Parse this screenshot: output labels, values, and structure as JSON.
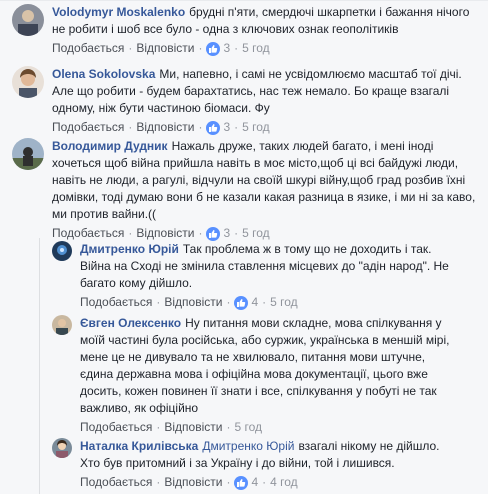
{
  "comments": [
    {
      "author": "Volodymyr Moskalenko",
      "lines": [
        "брудні п'яти, смердючі шкарпетки і бажання нічого",
        "не робити і шоб все було - одна з ключових ознак геополітиків"
      ],
      "like": "Подобається",
      "reply": "Відповісти",
      "likes": "3",
      "time": "5 год"
    },
    {
      "author": "Olena Sokolovska",
      "lines": [
        "Ми, напевно, і самі не усвідомлюємо масштаб тої дічі.",
        "Але що робити - будем барахтатись, нас теж немало. Бо краще взагалі",
        "одному, ніж бути частиною біомаси. Фу"
      ],
      "like": "Подобається",
      "reply": "Відповісти",
      "likes": "3",
      "time": "5 год"
    },
    {
      "author": "Володимир Дудник",
      "lines": [
        "Нажаль друже, таких людей багато, і мені іноді",
        "хочеться щоб війна прийшла навіть в моє місто,щоб ці всі байдужі люди,",
        "навіть не люди, а рагулі, відчули на своїй шкурі війну,щоб град розбив їхні",
        "домівки, тоді думаю вони б не казали какая разница в язике, і ми ні за каво,",
        "ми против вайни.(("
      ],
      "like": "Подобається",
      "reply": "Відповісти",
      "likes": "3",
      "time": "5 год"
    },
    {
      "author": "Дмитренко Юрій",
      "lines": [
        "Так проблема ж в тому що не доходить і так.",
        "Війна на Сході не змінила ставлення місцевих до \"адін народ\". Не",
        "багато кому дійшло."
      ],
      "like": "Подобається",
      "reply": "Відповісти",
      "likes": "4",
      "time": "5 год"
    },
    {
      "author": "Євген Олексенко",
      "lines": [
        "Ну питання мови складне, мова спілкування у",
        "моїй частині була російська, або суржик, українська в меншій мірі,",
        "мене це не дивувало та не хвилювало, питання мови штучне,",
        "єдина державна мова і офіційна мова документації, цього вже",
        "досить, кожен повинен її знати і все, спілкування у побуті не так",
        "важливо, як офіційно"
      ],
      "like": "Подобається",
      "reply": "Відповісти",
      "likes": "",
      "time": "5 год"
    },
    {
      "author": "Наталка Крилівська",
      "mention": "Дмитренко Юрій",
      "lines": [
        "взагалі нікому не дійшло.",
        "Хто був притомний і за Україну і до війни, той і лишився."
      ],
      "like": "Подобається",
      "reply": "Відповісти",
      "likes": "4",
      "time": "4 год"
    }
  ],
  "colors": {
    "link": "#365899",
    "background": "#f6f7f9",
    "like_blue": "#5890ff",
    "meta": "#90949c"
  },
  "icons": {
    "like": "thumbs-up-icon"
  }
}
